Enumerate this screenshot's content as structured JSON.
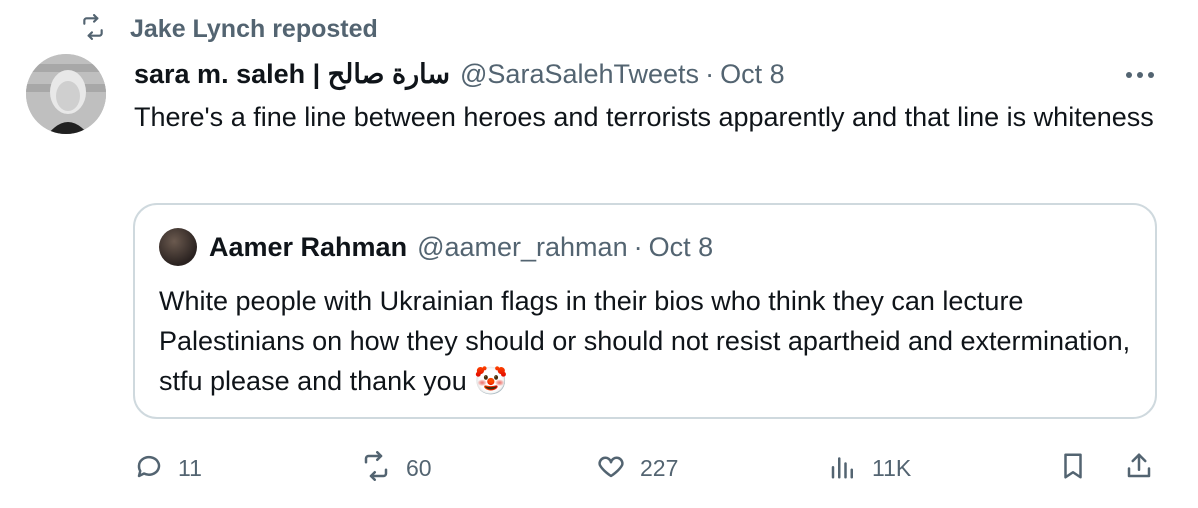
{
  "repost": {
    "label": "Jake Lynch reposted"
  },
  "tweet": {
    "author_name": "sara m. saleh | سارة صالح",
    "handle": "@SaraSalehTweets",
    "separator": "·",
    "date": "Oct 8",
    "text": "There's a fine line between heroes and terrorists apparently and that line is whiteness"
  },
  "quote": {
    "author_name": "Aamer Rahman",
    "handle": "@aamer_rahman",
    "separator": "·",
    "date": "Oct 8",
    "text": "White people with Ukrainian flags in their bios who think they can lecture Palestinians on how they should or should not resist apartheid and extermination, stfu please and thank you 🤡"
  },
  "actions": {
    "replies": "11",
    "reposts": "60",
    "likes": "227",
    "views": "11K"
  },
  "colors": {
    "text": "#0f1419",
    "muted": "#536471",
    "border": "#cfd9de"
  },
  "icons": [
    "repost-icon",
    "more-icon",
    "reply-icon",
    "retweet-icon",
    "like-icon",
    "views-icon",
    "bookmark-icon",
    "share-icon"
  ]
}
